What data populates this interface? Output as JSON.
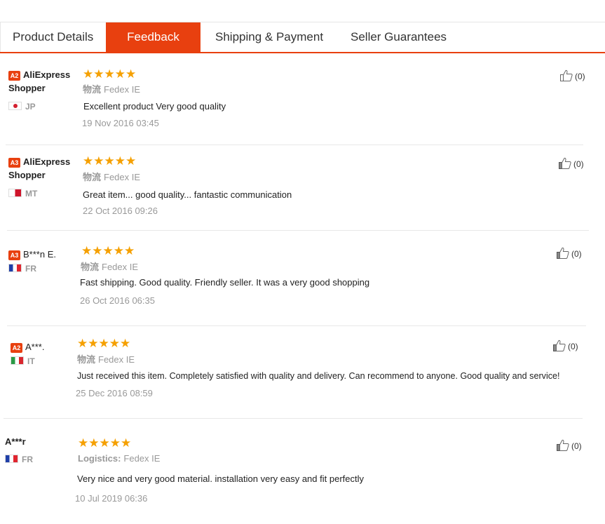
{
  "tabs": [
    {
      "label": "Product Details"
    },
    {
      "label": "Feedback"
    },
    {
      "label": "Shipping & Payment"
    },
    {
      "label": "Seller Guarantees"
    }
  ],
  "active_tab": "Feedback",
  "colors": {
    "accent": "#e8400f",
    "star": "#f5a000"
  },
  "reviews": [
    {
      "badge": "A2",
      "user_line1": "AliExpress",
      "user_line2": "Shopper",
      "country": "JP",
      "stars": "★★★★★",
      "logistics_label": "物流",
      "logistics_value": "Fedex IE",
      "text": "Excellent product Very good quality",
      "date": "19 Nov 2016 03:45",
      "helpful": "(0)"
    },
    {
      "badge": "A3",
      "user_line1": "AliExpress",
      "user_line2": "Shopper",
      "country": "MT",
      "stars": "★★★★★",
      "logistics_label": "物流",
      "logistics_value": "Fedex IE",
      "text": "Great item... good quality... fantastic communication",
      "date": "22 Oct 2016 09:26",
      "helpful": "(0)"
    },
    {
      "badge": "A3",
      "user_line1": "B***n E.",
      "country": "FR",
      "stars": "★★★★★",
      "logistics_label": "物流",
      "logistics_value": "Fedex IE",
      "text": "Fast shipping. Good quality. Friendly seller. It was a very good shopping",
      "date": "26 Oct 2016 06:35",
      "helpful": "(0)"
    },
    {
      "badge": "A2",
      "user_line1": "A***.",
      "country": "IT",
      "stars": "★★★★★",
      "logistics_label": "物流",
      "logistics_value": "Fedex IE",
      "text": "Just received this item. Completely satisfied with quality and delivery. Can recommend to anyone. Good quality and service!",
      "date": "25 Dec 2016 08:59",
      "helpful": "(0)"
    },
    {
      "user_line1": "A***r",
      "country": "FR",
      "stars": "★★★★★",
      "logistics_label": "Logistics:",
      "logistics_value": "Fedex IE",
      "text": "Very nice and very good material. installation very easy and fit perfectly",
      "date": "10 Jul 2019 06:36",
      "helpful": "(0)"
    }
  ]
}
